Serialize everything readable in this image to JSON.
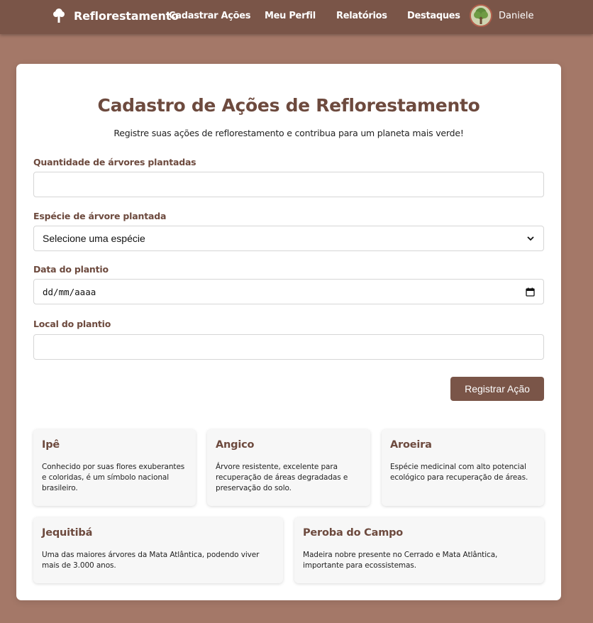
{
  "nav": {
    "brand": "Reflorestamento",
    "links": [
      "Cadastrar Ações",
      "Meu Perfil",
      "Relatórios",
      "Destaques"
    ],
    "user": "Daniele"
  },
  "form": {
    "title": "Cadastro de Ações de Reflorestamento",
    "subtitle": "Registre suas ações de reflorestamento e contribua para um planeta mais verde!",
    "quantity_label": "Quantidade de árvores plantadas",
    "quantity_value": "",
    "species_label": "Espécie de árvore plantada",
    "species_selected": "Selecione uma espécie",
    "date_label": "Data do plantio",
    "date_placeholder": "dd/mm/aaaa",
    "location_label": "Local do plantio",
    "location_value": "",
    "submit_label": "Registrar Ação"
  },
  "species": [
    {
      "name": "Ipê",
      "description": "Conhecido por suas flores exuberantes e coloridas, é um símbolo nacional brasileiro."
    },
    {
      "name": "Angico",
      "description": "Árvore resistente, excelente para recuperação de áreas degradadas e preservação do solo."
    },
    {
      "name": "Aroeira",
      "description": "Espécie medicinal com alto potencial ecológico para recuperação de áreas."
    },
    {
      "name": "Jequitibá",
      "description": "Uma das maiores árvores da Mata Atlântica, podendo viver mais de 3.000 anos."
    },
    {
      "name": "Peroba do Campo",
      "description": "Madeira nobre presente no Cerrado e Mata Atlântica, importante para ecossistemas."
    }
  ],
  "colors": {
    "background": "#a47868",
    "navbar": "#7a5548",
    "accent": "#6d4a3e",
    "button": "#7a5548"
  },
  "icons": {
    "brand": "tree-icon",
    "select": "chevron-down-icon",
    "date": "calendar-icon"
  }
}
